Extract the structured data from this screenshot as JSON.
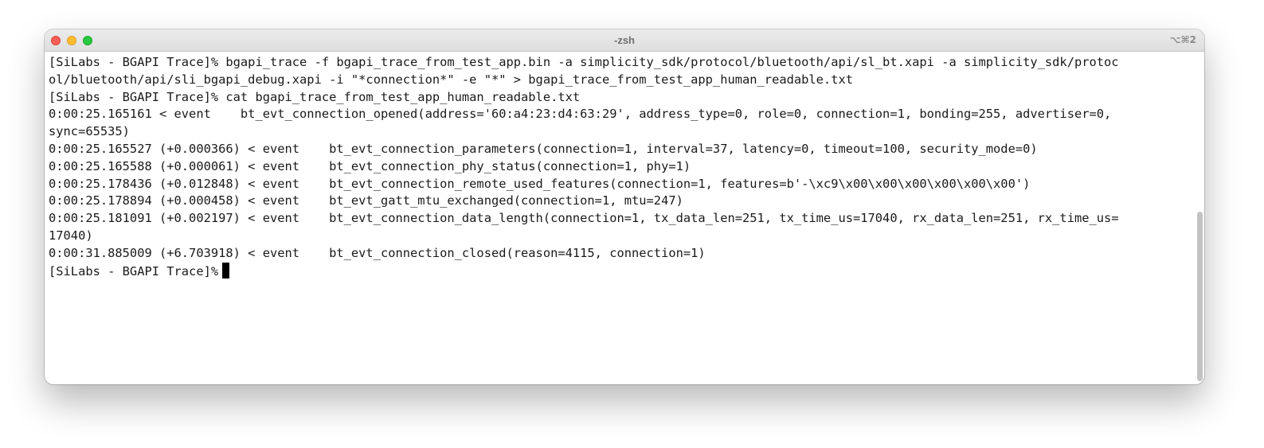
{
  "window": {
    "title": "-zsh",
    "shortcut": "⌥⌘2"
  },
  "terminal": {
    "lines": [
      "[SiLabs - BGAPI Trace]% bgapi_trace -f bgapi_trace_from_test_app.bin -a simplicity_sdk/protocol/bluetooth/api/sl_bt.xapi -a simplicity_sdk/protoc",
      "ol/bluetooth/api/sli_bgapi_debug.xapi -i \"*connection*\" -e \"*\" > bgapi_trace_from_test_app_human_readable.txt",
      "[SiLabs - BGAPI Trace]% cat bgapi_trace_from_test_app_human_readable.txt",
      "0:00:25.165161 < event    bt_evt_connection_opened(address='60:a4:23:d4:63:29', address_type=0, role=0, connection=1, bonding=255, advertiser=0,",
      "sync=65535)",
      "0:00:25.165527 (+0.000366) < event    bt_evt_connection_parameters(connection=1, interval=37, latency=0, timeout=100, security_mode=0)",
      "0:00:25.165588 (+0.000061) < event    bt_evt_connection_phy_status(connection=1, phy=1)",
      "0:00:25.178436 (+0.012848) < event    bt_evt_connection_remote_used_features(connection=1, features=b'-\\xc9\\x00\\x00\\x00\\x00\\x00\\x00')",
      "0:00:25.178894 (+0.000458) < event    bt_evt_gatt_mtu_exchanged(connection=1, mtu=247)",
      "0:00:25.181091 (+0.002197) < event    bt_evt_connection_data_length(connection=1, tx_data_len=251, tx_time_us=17040, rx_data_len=251, rx_time_us=",
      "17040)",
      "0:00:31.885009 (+6.703918) < event    bt_evt_connection_closed(reason=4115, connection=1)"
    ],
    "prompt": "[SiLabs - BGAPI Trace]%"
  },
  "colors": {
    "close": "#ff5f57",
    "minimize": "#febc2e",
    "maximize": "#28c840"
  }
}
